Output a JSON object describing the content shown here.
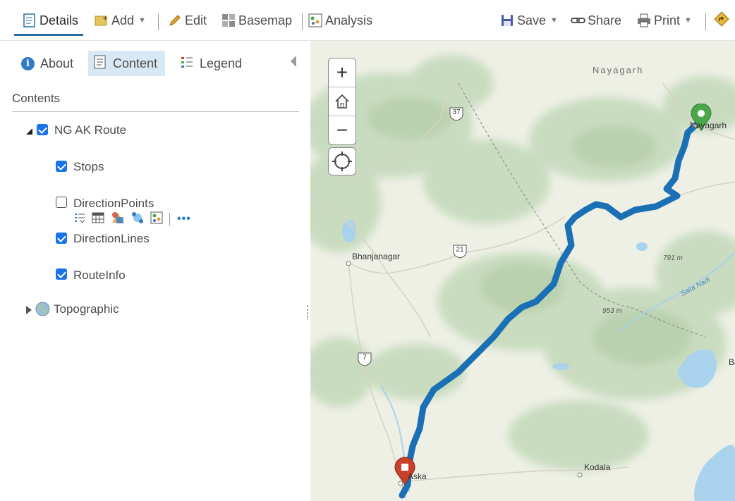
{
  "toolbar": {
    "details": "Details",
    "add": "Add",
    "edit": "Edit",
    "basemap": "Basemap",
    "analysis": "Analysis",
    "save": "Save",
    "share": "Share",
    "print": "Print",
    "directions_icon": "directions-icon",
    "accent_color": "#2b6ca3"
  },
  "panel": {
    "tabs": [
      {
        "label": "About",
        "icon": "info-icon"
      },
      {
        "label": "Content",
        "icon": "content-icon",
        "active": true
      },
      {
        "label": "Legend",
        "icon": "legend-icon"
      }
    ],
    "contents_title": "Contents",
    "group": {
      "label": "NG AK Route",
      "checked": true,
      "expanded": true
    },
    "layers": [
      {
        "label": "Stops",
        "checked": true
      },
      {
        "label": "DirectionPoints",
        "checked": false
      },
      {
        "label": "DirectionLines",
        "checked": true
      },
      {
        "label": "RouteInfo",
        "checked": true
      }
    ],
    "basemap_layer": {
      "label": "Topographic",
      "expanded": false
    },
    "layer_tools": [
      "show-legend-icon",
      "attribute-table-icon",
      "change-style-icon",
      "perform-analysis-icon",
      "more-options-icon"
    ]
  },
  "map": {
    "zoom_in": "+",
    "zoom_out": "−",
    "places": {
      "nayagarh_region": "Nayagarh",
      "nayagarh_town": "Nayagarh",
      "bhanjanagar": "Bhanjanagar",
      "kodala": "Kodala",
      "aska": "Aska",
      "edge_b": "Ba"
    },
    "shields": {
      "s37": "37",
      "s21": "21",
      "s7": "7"
    },
    "elevations": {
      "e1": "791 m",
      "e2": "953 m"
    },
    "river": "Salia Nadi",
    "route_color": "#1a6fb5",
    "start_marker_color": "#4aa84a",
    "end_marker_color": "#c8412b"
  }
}
